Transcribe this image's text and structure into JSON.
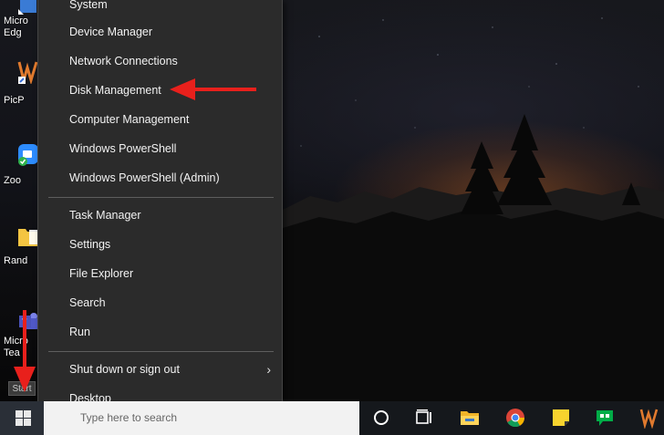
{
  "context_menu": {
    "items": [
      {
        "label": "System"
      },
      {
        "label": "Device Manager"
      },
      {
        "label": "Network Connections"
      },
      {
        "label": "Disk Management"
      },
      {
        "label": "Computer Management"
      },
      {
        "label": "Windows PowerShell"
      },
      {
        "label": "Windows PowerShell (Admin)"
      },
      {
        "label": "Task Manager"
      },
      {
        "label": "Settings"
      },
      {
        "label": "File Explorer"
      },
      {
        "label": "Search"
      },
      {
        "label": "Run"
      },
      {
        "label": "Shut down or sign out"
      },
      {
        "label": "Desktop"
      }
    ]
  },
  "desktop_icons": [
    {
      "label": "Micro\nEdg",
      "icon": "edge-icon"
    },
    {
      "label": "PicP",
      "icon": "picpick-icon"
    },
    {
      "label": "Zoo",
      "icon": "zoom-icon"
    },
    {
      "label": "Rand",
      "icon": "folder-icon"
    },
    {
      "label": "Micro\nTea",
      "icon": "teams-icon"
    }
  ],
  "taskbar": {
    "start_tooltip": "Start",
    "search_placeholder": "Type here to search",
    "apps": [
      "cortana-icon",
      "task-view-icon",
      "file-explorer-icon",
      "chrome-icon",
      "sticky-notes-icon",
      "google-chat-icon",
      "picpick-icon"
    ]
  },
  "colors": {
    "menu_bg": "#2b2b2b",
    "menu_text": "#f2f2f2",
    "annotation_arrow": "#e8201c"
  }
}
